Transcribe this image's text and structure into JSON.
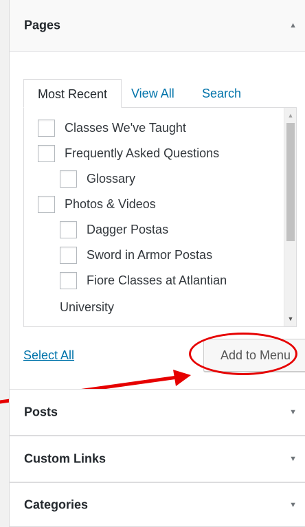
{
  "pages": {
    "title": "Pages",
    "tabs": [
      "Most Recent",
      "View All",
      "Search"
    ],
    "items": [
      {
        "label": "Classes We've Taught",
        "level": 0
      },
      {
        "label": "Frequently Asked Questions",
        "level": 0
      },
      {
        "label": "Glossary",
        "level": 1
      },
      {
        "label": "Photos & Videos",
        "level": 0
      },
      {
        "label": "Dagger Postas",
        "level": 1
      },
      {
        "label": "Sword in Armor Postas",
        "level": 1
      },
      {
        "label": "Fiore Classes at Atlantian",
        "level": 1
      }
    ],
    "overflow_text": "University",
    "select_all": "Select All",
    "add_button": "Add to Menu"
  },
  "sections": [
    {
      "title": "Posts"
    },
    {
      "title": "Custom Links"
    },
    {
      "title": "Categories"
    }
  ],
  "icons": {
    "collapse": "arrow-up-icon",
    "expand": "arrow-down-icon"
  },
  "colors": {
    "link": "#0073aa",
    "annotation": "#e60000"
  }
}
